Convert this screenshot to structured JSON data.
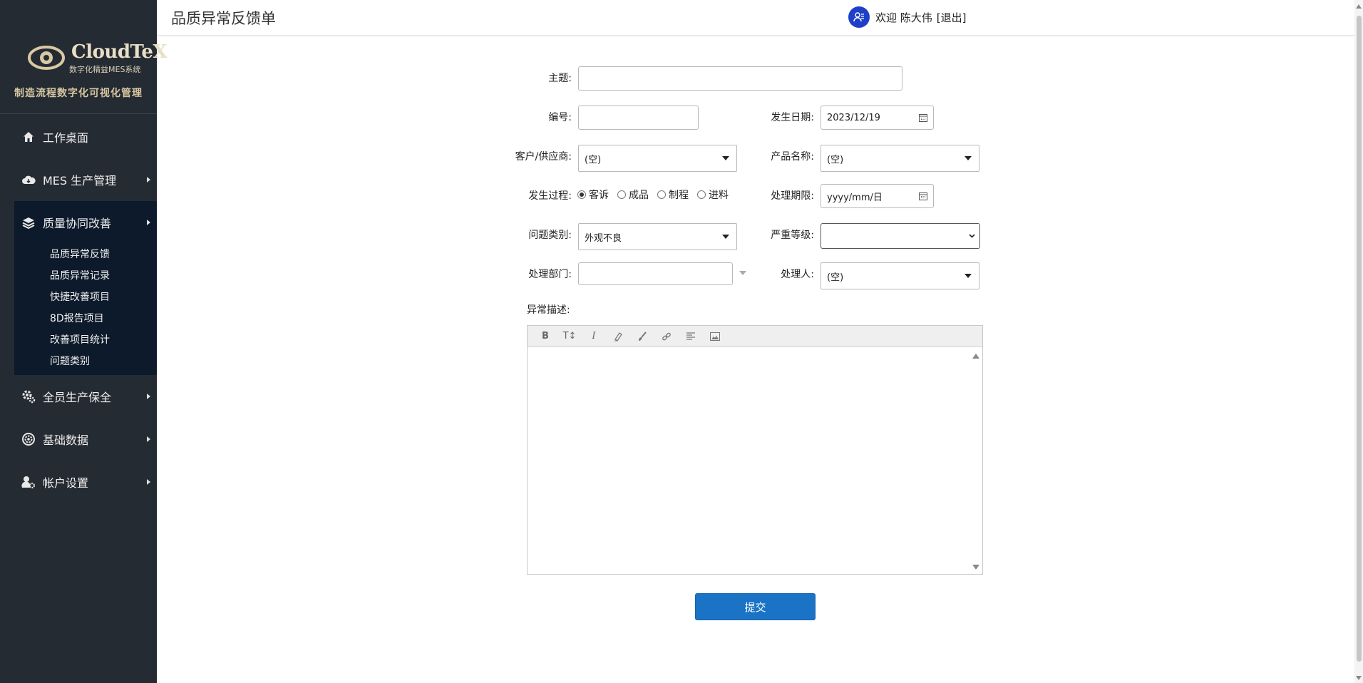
{
  "sidebar": {
    "logo_title": "CloudTeX",
    "logo_sub": "数字化精益MES系统",
    "slogan": "制造流程数字化可视化管理",
    "items": [
      {
        "label": "工作桌面",
        "icon": "home-icon"
      },
      {
        "label": "MES 生产管理",
        "icon": "cloud-icon"
      },
      {
        "label": "质量协同改善",
        "icon": "layers-icon"
      },
      {
        "label": "全员生产保全",
        "icon": "gears-icon"
      },
      {
        "label": "基础数据",
        "icon": "settings-icon"
      },
      {
        "label": "帐户设置",
        "icon": "user-settings-icon"
      }
    ],
    "sub_items": [
      "品质异常反馈",
      "品质异常记录",
      "快捷改善项目",
      "8D报告项目",
      "改善项目统计",
      "问题类别"
    ]
  },
  "header": {
    "title": "品质异常反馈单",
    "welcome": "欢迎 陈大伟",
    "logout": "[退出]"
  },
  "form": {
    "subject_label": "主题:",
    "subject_value": "",
    "number_label": "编号:",
    "number_value": "",
    "date_label": "发生日期:",
    "date_value": "2023/12/19",
    "customer_label": "客户/供应商:",
    "customer_value": "(空)",
    "product_label": "产品名称:",
    "product_value": "(空)",
    "process_label": "发生过程:",
    "process_options": [
      "客诉",
      "成品",
      "制程",
      "进料"
    ],
    "process_selected": 0,
    "deadline_label": "处理期限:",
    "deadline_placeholder": "yyyy/mm/日",
    "category_label": "问题类别:",
    "category_value": "外观不良",
    "severity_label": "严重等级:",
    "severity_value": "",
    "dept_label": "处理部门:",
    "dept_value": "",
    "handler_label": "处理人:",
    "handler_value": "(空)",
    "desc_label": "异常描述:",
    "submit_label": "提交"
  },
  "colors": {
    "sidebar_bg": "#252b33",
    "sidebar_active_bg": "#0d1a2b",
    "accent": "#1a73c5",
    "avatar": "#1e40c8"
  }
}
